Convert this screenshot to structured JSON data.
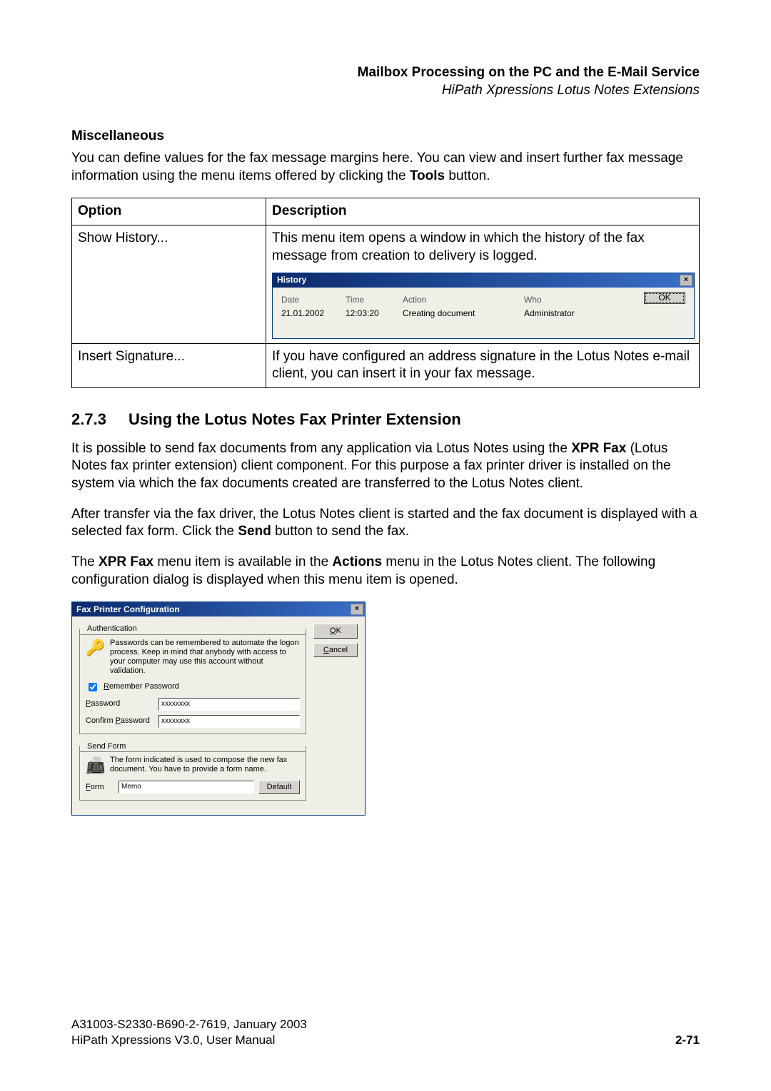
{
  "header": {
    "title": "Mailbox Processing on the PC and the E-Mail Service",
    "subtitle": "HiPath Xpressions Lotus Notes Extensions"
  },
  "misc": {
    "heading": "Miscellaneous",
    "intro_before": "You can define values for the fax message margins here. You can view and insert further fax message information using the menu items offered by clicking the ",
    "intro_bold": "Tools",
    "intro_after": " button."
  },
  "table": {
    "col1": "Option",
    "col2": "Description",
    "rows": [
      {
        "option": "Show History...",
        "desc": "This menu item opens a window in which the history of the fax message from creation to delivery is logged."
      },
      {
        "option": "Insert Signature...",
        "desc": "If you have configured an address signature in the Lotus Notes e-mail client, you can insert it in your fax message."
      }
    ]
  },
  "history_win": {
    "title": "History",
    "close": "×",
    "ok": "OK",
    "cols": {
      "date": "Date",
      "time": "Time",
      "action": "Action",
      "who": "Who"
    },
    "row": {
      "date": "21.01.2002",
      "time": "12:03:20",
      "action": "Creating document",
      "who": "Administrator"
    }
  },
  "section273": {
    "number": "2.7.3",
    "title": "Using the Lotus Notes Fax Printer Extension",
    "p1a": "It is possible to send fax documents from any application via Lotus Notes using the ",
    "p1b": "XPR Fax",
    "p1c": " (Lotus Notes fax printer extension) client component. For this purpose a fax printer driver is installed on the system via which the fax documents created are transferred to the Lotus Notes client.",
    "p2a": "After transfer via the fax driver, the Lotus Notes client is started and the fax document is displayed with a selected fax form. Click the ",
    "p2b": "Send",
    "p2c": " button to send the fax.",
    "p3a": "The ",
    "p3b": "XPR Fax",
    "p3c": " menu item is available in the ",
    "p3d": "Actions",
    "p3e": " menu in the Lotus Notes client. The following configuration dialog is displayed when this menu item is opened."
  },
  "fax_dlg": {
    "title": "Fax Printer Configuration",
    "close": "×",
    "ok_u": "O",
    "ok_rest": "K",
    "cancel_u": "C",
    "cancel_rest": "ancel",
    "auth": {
      "legend": "Authentication",
      "text": "Passwords can be remembered to automate the logon process. Keep in mind that anybody with access to your computer may use this account without validation.",
      "remember_u": "R",
      "remember_rest": "emember Password",
      "password_u": "P",
      "password_rest": "assword",
      "confirm_pre": "Confirm ",
      "confirm_u": "P",
      "confirm_rest": "assword",
      "pw_value": "xxxxxxxx",
      "confirm_value": "xxxxxxxx"
    },
    "sendform": {
      "legend": "Send Form",
      "text": "The form indicated is used to compose the new fax document. You have to provide a form name.",
      "form_u": "F",
      "form_rest": "orm",
      "form_value": "Memo",
      "default_btn": "Default"
    }
  },
  "footer": {
    "line1": "A31003-S2330-B690-2-7619, January 2003",
    "line2": "HiPath Xpressions V3.0, User Manual",
    "page": "2-71"
  }
}
